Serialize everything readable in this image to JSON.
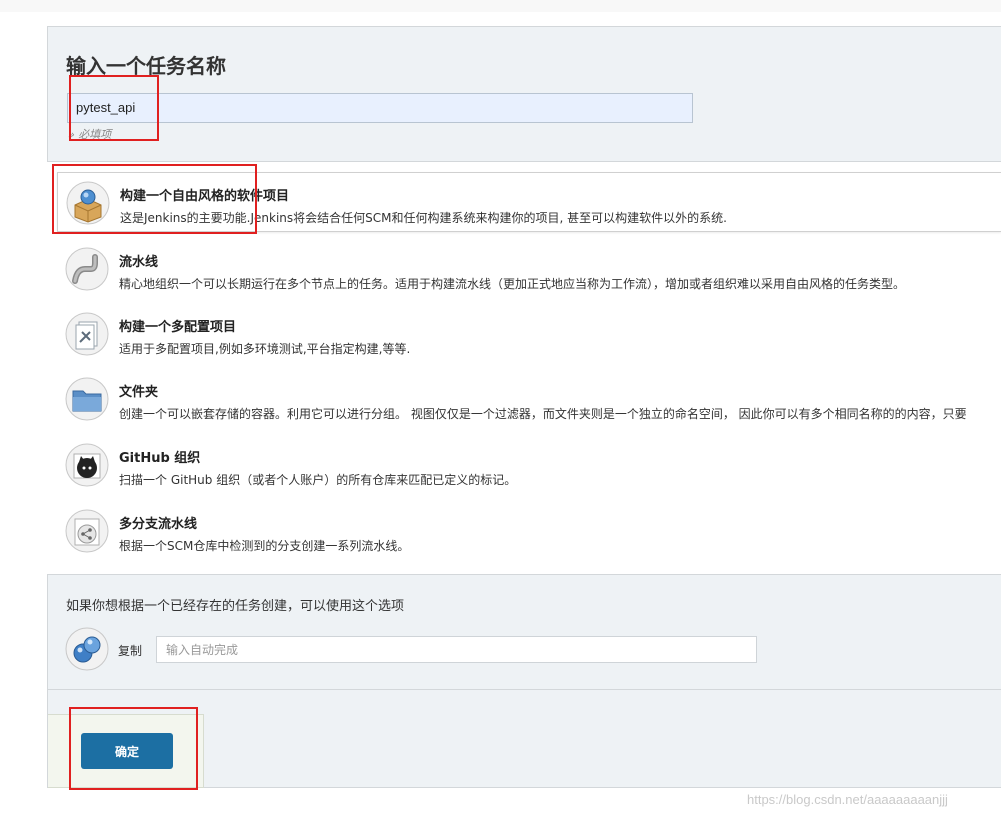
{
  "form": {
    "title": "输入一个任务名称",
    "name_value": "pytest_api",
    "required_note": "» 必填项"
  },
  "job_types": [
    {
      "label": "构建一个自由风格的软件项目",
      "desc": "这是Jenkins的主要功能.Jenkins将会结合任何SCM和任何构建系统来构建你的项目, 甚至可以构建软件以外的系统.",
      "icon": "freestyle-project-icon",
      "selected": true
    },
    {
      "label": "流水线",
      "desc": "精心地组织一个可以长期运行在多个节点上的任务。适用于构建流水线（更加正式地应当称为工作流），增加或者组织难以采用自由风格的任务类型。",
      "icon": "pipeline-icon",
      "selected": false
    },
    {
      "label": "构建一个多配置项目",
      "desc": "适用于多配置项目,例如多环境测试,平台指定构建,等等.",
      "icon": "multi-config-icon",
      "selected": false
    },
    {
      "label": "文件夹",
      "desc": "创建一个可以嵌套存储的容器。利用它可以进行分组。 视图仅仅是一个过滤器，而文件夹则是一个独立的命名空间， 因此你可以有多个相同名称的的内容，只要",
      "icon": "folder-icon",
      "selected": false
    },
    {
      "label": "GitHub 组织",
      "desc": "扫描一个 GitHub 组织（或者个人账户）的所有仓库来匹配已定义的标记。",
      "icon": "github-icon",
      "selected": false
    },
    {
      "label": "多分支流水线",
      "desc": "根据一个SCM仓库中检测到的分支创建一系列流水线。",
      "icon": "multibranch-icon",
      "selected": false
    }
  ],
  "copy": {
    "hint": "如果你想根据一个已经存在的任务创建，可以使用这个选项",
    "label": "复制",
    "placeholder": "输入自动完成"
  },
  "ok_button": "确定",
  "watermark": "https://blog.csdn.net/aaaaaaaaanjjj",
  "colors": {
    "accent": "#1c6fa3",
    "annotation": "#e02020",
    "panel_bg": "#eef2f5"
  }
}
